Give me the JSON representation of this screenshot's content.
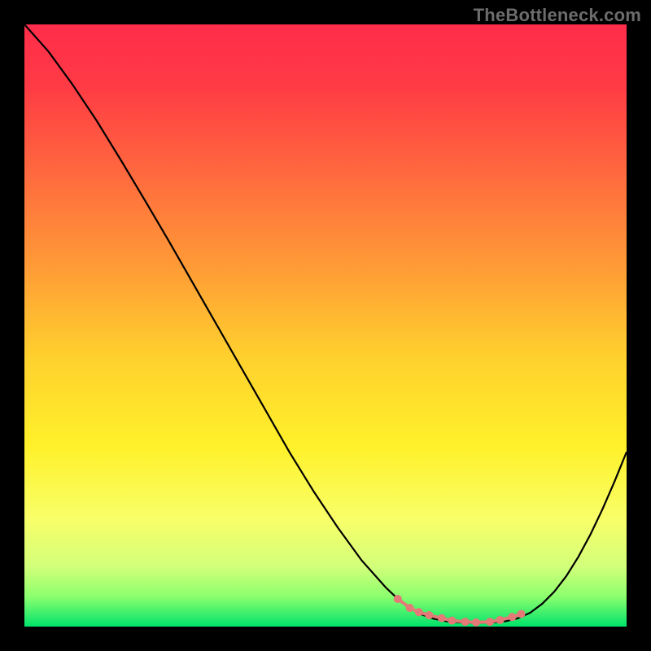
{
  "watermark": "TheBottleneck.com",
  "chart_data": {
    "type": "line",
    "title": "",
    "xlabel": "",
    "ylabel": "",
    "xlim": [
      0,
      100
    ],
    "ylim": [
      0,
      100
    ],
    "grid": false,
    "legend": false,
    "background_gradient": {
      "stops": [
        {
          "offset": 0.0,
          "color": "#ff2d4b"
        },
        {
          "offset": 0.1,
          "color": "#ff3a45"
        },
        {
          "offset": 0.25,
          "color": "#ff6a3e"
        },
        {
          "offset": 0.4,
          "color": "#ff9a36"
        },
        {
          "offset": 0.55,
          "color": "#ffd02e"
        },
        {
          "offset": 0.7,
          "color": "#fff12a"
        },
        {
          "offset": 0.82,
          "color": "#f9ff68"
        },
        {
          "offset": 0.9,
          "color": "#d3ff7a"
        },
        {
          "offset": 0.95,
          "color": "#8cff6e"
        },
        {
          "offset": 1.0,
          "color": "#00e36b"
        }
      ]
    },
    "series": [
      {
        "name": "curve",
        "color": "#000000",
        "width": 2.2,
        "x": [
          0,
          4,
          8,
          12,
          16,
          20,
          24,
          28,
          32,
          36,
          40,
          44,
          48,
          52,
          56,
          60,
          62,
          64,
          66,
          68,
          70,
          72,
          74,
          76,
          78,
          80,
          82,
          84,
          86,
          88,
          90,
          92,
          94,
          96,
          98,
          100
        ],
        "y": [
          100,
          95.5,
          90,
          84,
          77.5,
          70.8,
          64,
          57,
          50,
          43,
          36,
          29,
          22.5,
          16.5,
          11,
          6.5,
          4.6,
          3.1,
          2.0,
          1.3,
          0.9,
          0.7,
          0.6,
          0.6,
          0.7,
          0.9,
          1.4,
          2.3,
          3.8,
          5.8,
          8.4,
          11.6,
          15.3,
          19.5,
          24.1,
          29.0
        ]
      }
    ],
    "markers": {
      "name": "hotspots",
      "color": "#e47a77",
      "radius": 5,
      "connect": true,
      "x": [
        62,
        64,
        65.5,
        67.2,
        69.3,
        71.0,
        73.2,
        75.0,
        77.3,
        79.0,
        81.0,
        82.5
      ],
      "y": [
        4.6,
        3.1,
        2.4,
        1.9,
        1.4,
        1.0,
        0.8,
        0.7,
        0.8,
        1.1,
        1.6,
        2.1
      ]
    }
  }
}
